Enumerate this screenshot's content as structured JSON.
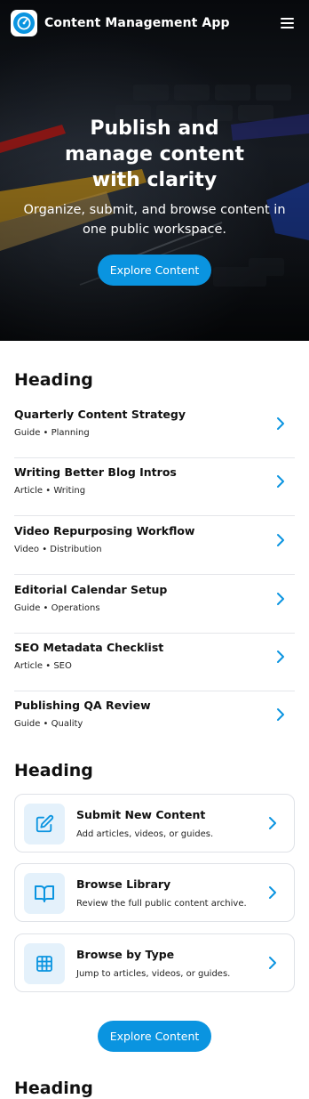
{
  "header": {
    "app_title": "Content Management App",
    "logo_icon": "gauge-icon",
    "menu_icon": "hamburger-menu-icon"
  },
  "hero": {
    "title": "Publish and manage content with clarity",
    "subtitle": "Organize, submit, and browse content in one public workspace.",
    "cta_label": "Explore Content"
  },
  "content_list": {
    "heading": "Heading",
    "items": [
      {
        "title": "Quarterly Content Strategy",
        "meta": "Guide • Planning"
      },
      {
        "title": "Writing Better Blog Intros",
        "meta": "Article • Writing"
      },
      {
        "title": "Video Repurposing Workflow",
        "meta": "Video • Distribution"
      },
      {
        "title": "Editorial Calendar Setup",
        "meta": "Guide • Operations"
      },
      {
        "title": "SEO Metadata Checklist",
        "meta": "Article • SEO"
      },
      {
        "title": "Publishing QA Review",
        "meta": "Guide • Quality"
      }
    ]
  },
  "actions": {
    "heading": "Heading",
    "cards": [
      {
        "title": "Submit New Content",
        "desc": "Add articles, videos, or guides.",
        "icon": "edit-icon"
      },
      {
        "title": "Browse Library",
        "desc": "Review the full public content archive.",
        "icon": "book-icon"
      },
      {
        "title": "Browse by Type",
        "desc": "Jump to articles, videos, or guides.",
        "icon": "grid-icon"
      }
    ],
    "cta_label": "Explore Content"
  },
  "footer_section": {
    "heading": "Heading"
  },
  "colors": {
    "accent": "#0a94e0",
    "icon_bg": "#e4f1fb",
    "divider": "#e4e6ea"
  }
}
